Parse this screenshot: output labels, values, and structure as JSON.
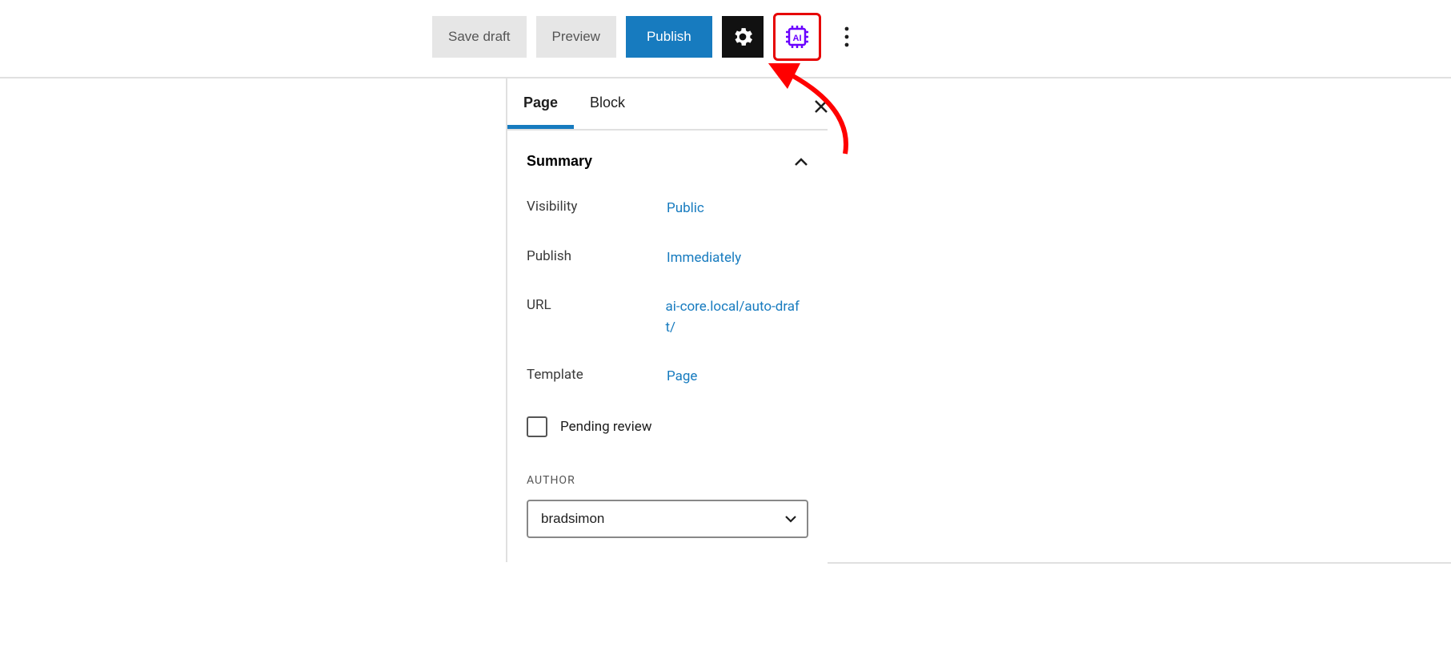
{
  "toolbar": {
    "save_draft": "Save draft",
    "preview": "Preview",
    "publish": "Publish"
  },
  "tabs": {
    "page": "Page",
    "block": "Block"
  },
  "summary": {
    "title": "Summary",
    "visibility_label": "Visibility",
    "visibility_value": "Public",
    "publish_label": "Publish",
    "publish_value": "Immediately",
    "url_label": "URL",
    "url_value": "ai-core.local/auto-draft/",
    "template_label": "Template",
    "template_value": "Page",
    "pending_review": "Pending review"
  },
  "author": {
    "label": "AUTHOR",
    "value": "bradsimon"
  }
}
